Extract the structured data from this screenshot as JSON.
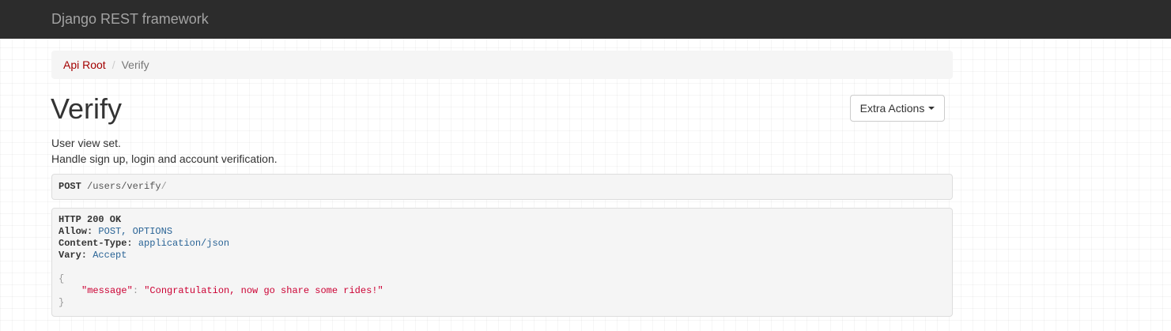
{
  "navbar": {
    "brand": "Django REST framework"
  },
  "breadcrumb": {
    "root_label": "Api Root",
    "separator": "/",
    "current_label": "Verify"
  },
  "page": {
    "title": "Verify",
    "description_lines": [
      "User view set.",
      "Handle sign up, login and account verification."
    ]
  },
  "extra_actions": {
    "label": "Extra Actions"
  },
  "request": {
    "method": "POST",
    "path": "/users/verify",
    "trailing_slash": "/"
  },
  "response": {
    "status": "HTTP 200 OK",
    "headers": [
      {
        "key": "Allow:",
        "value": "POST, OPTIONS"
      },
      {
        "key": "Content-Type:",
        "value": "application/json"
      },
      {
        "key": "Vary:",
        "value": "Accept"
      }
    ],
    "body": {
      "open_brace": "{",
      "key": "\"message\"",
      "colon": ":",
      "value": "\"Congratulation, now go share some rides!\"",
      "close_brace": "}"
    }
  },
  "colors": {
    "navbar_bg": "#2c2c2c",
    "brand_text": "#a3a3a3",
    "link": "#a30000",
    "header_value": "#2a6496",
    "json_string": "#cc0033"
  }
}
